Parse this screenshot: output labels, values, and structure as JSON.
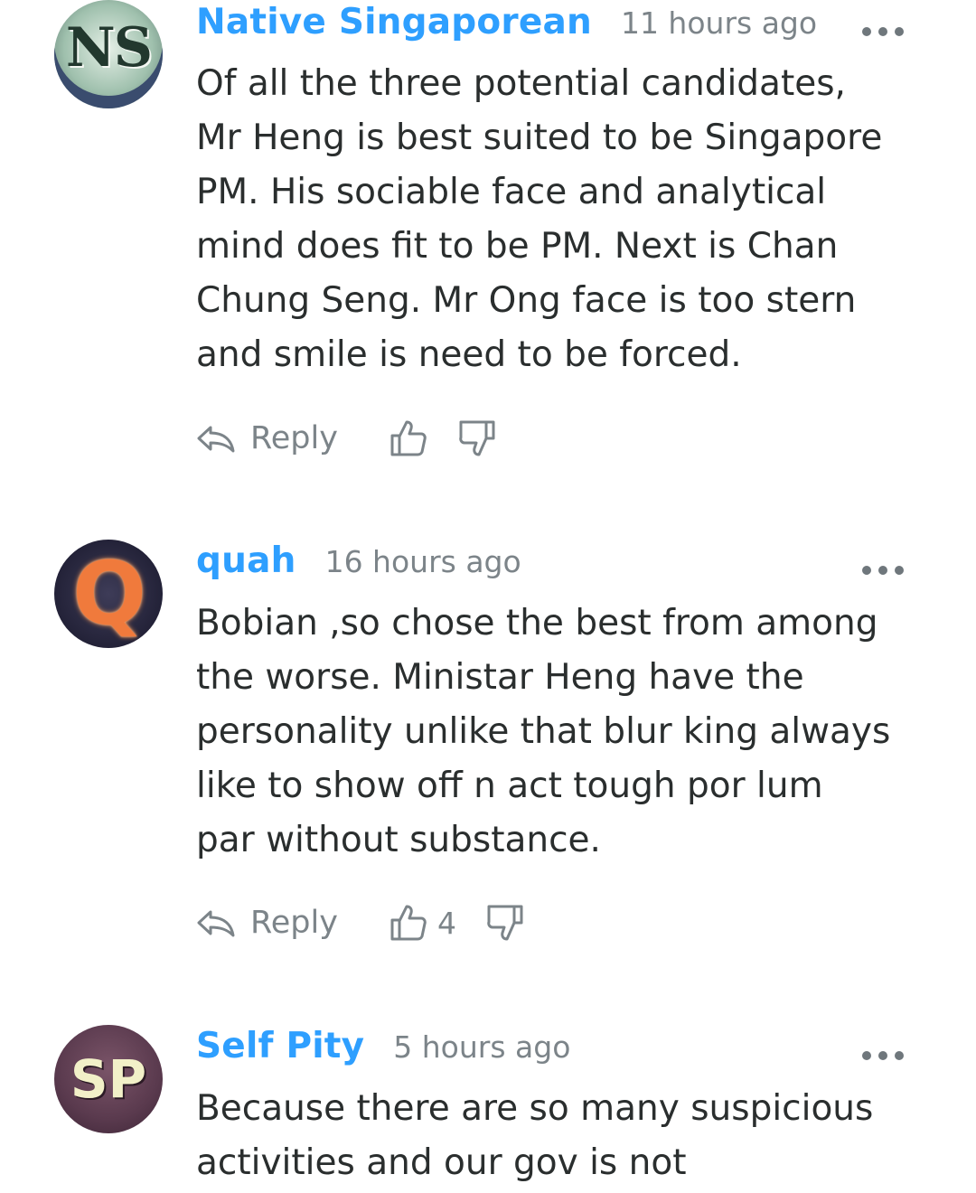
{
  "comments": [
    {
      "avatar_text": "NS",
      "author": "Native Singaporean",
      "timestamp": "11 hours ago",
      "text": "Of all the three potential candidates,\nMr Heng is best suited to be Singapore\nPM. His sociable face and analytical\nmind does fit to be PM. Next is Chan\nChung Seng. Mr Ong face is too stern\nand smile is need to be forced.",
      "reply_label": "Reply",
      "upvotes": ""
    },
    {
      "avatar_text": "Q",
      "author": "quah",
      "timestamp": "16 hours ago",
      "text": "Bobian ,so chose the best from among\nthe worse. Ministar Heng have the\npersonality unlike that blur king always\nlike to show off n act tough por lum\npar without substance.",
      "reply_label": "Reply",
      "upvotes": "4"
    },
    {
      "avatar_text": "SP",
      "author": "Self Pity",
      "timestamp": "5 hours ago",
      "text": "Because there are so many suspicious\nactivities and our gov is not"
    }
  ],
  "icons": {
    "more": "more-options-icon",
    "reply": "reply-arrow-icon",
    "upvote": "thumbs-up-icon",
    "downvote": "thumbs-down-icon"
  },
  "colors": {
    "author": "#2e9fff",
    "body_text": "#2a2e2e",
    "muted": "#7c8489"
  }
}
